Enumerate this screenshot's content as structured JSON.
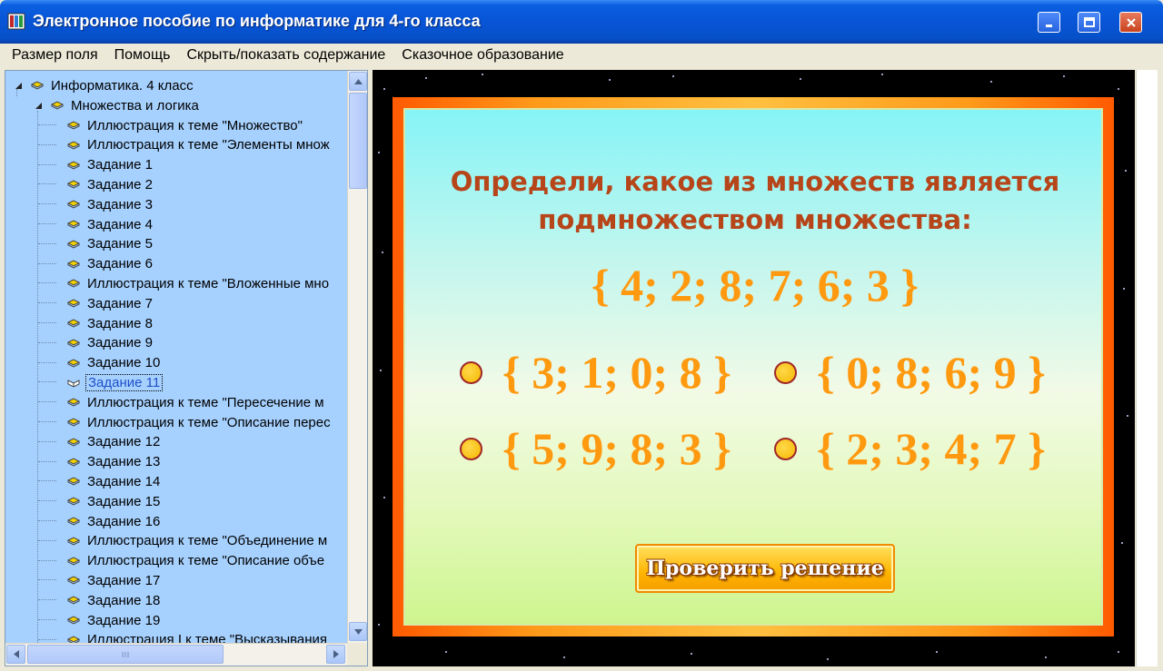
{
  "window": {
    "title": "Электронное пособие по информатике для 4-го класса"
  },
  "menu": [
    "Размер поля",
    "Помощь",
    "Скрыть/показать содержание",
    "Сказочное образование"
  ],
  "tree": {
    "root": "Информатика. 4 класс",
    "section": "Множества и логика",
    "items": [
      "Иллюстрация к теме \"Множество\"",
      "Иллюстрация к теме \"Элементы множ",
      "Задание 1",
      "Задание 2",
      "Задание 3",
      "Задание 4",
      "Задание 5",
      "Задание 6",
      "Иллюстрация к теме \"Вложенные мно",
      "Задание 7",
      "Задание 8",
      "Задание 9",
      "Задание 10",
      "Задание 11",
      "Иллюстрация к теме \"Пересечение м",
      "Иллюстрация к теме \"Описание перес",
      "Задание 12",
      "Задание 13",
      "Задание 14",
      "Задание 15",
      "Задание 16",
      "Иллюстрация к теме \"Объединение м",
      "Иллюстрация к теме \"Описание объе",
      "Задание 17",
      "Задание 18",
      "Задание 19",
      "Иллюстрация I к теме \"Высказывания"
    ],
    "selected_item": "Задание 11"
  },
  "task": {
    "question_line1": "Определи, какое из множеств является",
    "question_line2": "подмножеством множества:",
    "main_set": "{ 4; 2; 8; 7; 6; 3 }",
    "options": [
      "{ 3; 1; 0; 8 }",
      "{ 0; 8; 6; 9 }",
      "{ 5; 9; 8; 3 }",
      "{ 2; 3; 4; 7 }"
    ],
    "check_button": "Проверить решение"
  },
  "colors": {
    "titlebar": "#0854d6",
    "tree_bg": "#a6d1ff",
    "question_text": "#b7451a",
    "set_text": "#ff9a10",
    "frame": "#ff7a00"
  }
}
